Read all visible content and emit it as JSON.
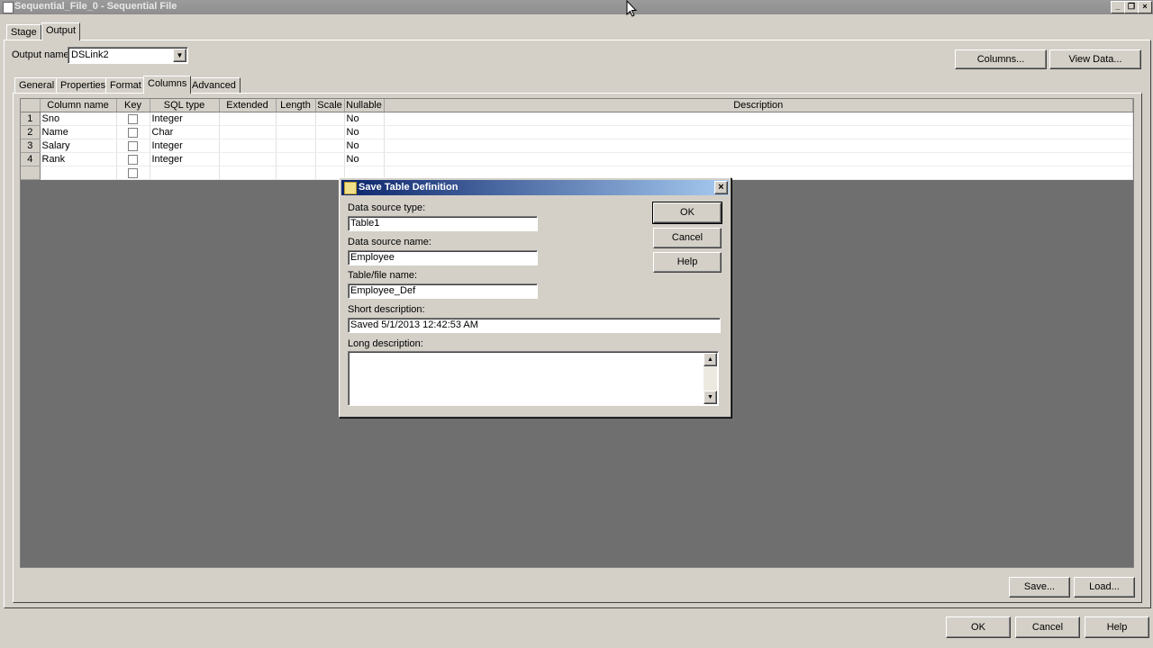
{
  "window": {
    "title": "Sequential_File_0 - Sequential File"
  },
  "stage_tabs": [
    "Stage",
    "Output"
  ],
  "output_name": {
    "label": "Output name:",
    "value": "DSLink2"
  },
  "top_buttons": {
    "columns": "Columns...",
    "view_data": "View Data..."
  },
  "inner_tabs": [
    "General",
    "Properties",
    "Format",
    "Columns",
    "Advanced"
  ],
  "grid": {
    "headers": [
      "Column name",
      "Key",
      "SQL type",
      "Extended",
      "Length",
      "Scale",
      "Nullable",
      "Description"
    ],
    "rows": [
      {
        "num": "1",
        "name": "Sno",
        "type": "Integer",
        "nullable": "No"
      },
      {
        "num": "2",
        "name": "Name",
        "type": "Char",
        "nullable": "No"
      },
      {
        "num": "3",
        "name": "Salary",
        "type": "Integer",
        "nullable": "No"
      },
      {
        "num": "4",
        "name": "Rank",
        "type": "Integer",
        "nullable": "No"
      }
    ]
  },
  "bottom_buttons": {
    "save": "Save...",
    "load": "Load..."
  },
  "footer_buttons": {
    "ok": "OK",
    "cancel": "Cancel",
    "help": "Help"
  },
  "dialog": {
    "title": "Save Table Definition",
    "close": "×",
    "ds_type_label": "Data source type:",
    "ds_type_value": "Table1",
    "ds_name_label": "Data source name:",
    "ds_name_value": "Employee",
    "table_label": "Table/file name:",
    "table_value": "Employee_Def",
    "short_label": "Short description:",
    "short_value": "Saved 5/1/2013 12:42:53 AM",
    "long_label": "Long description:",
    "long_value": "",
    "ok": "OK",
    "cancel": "Cancel",
    "help": "Help"
  }
}
